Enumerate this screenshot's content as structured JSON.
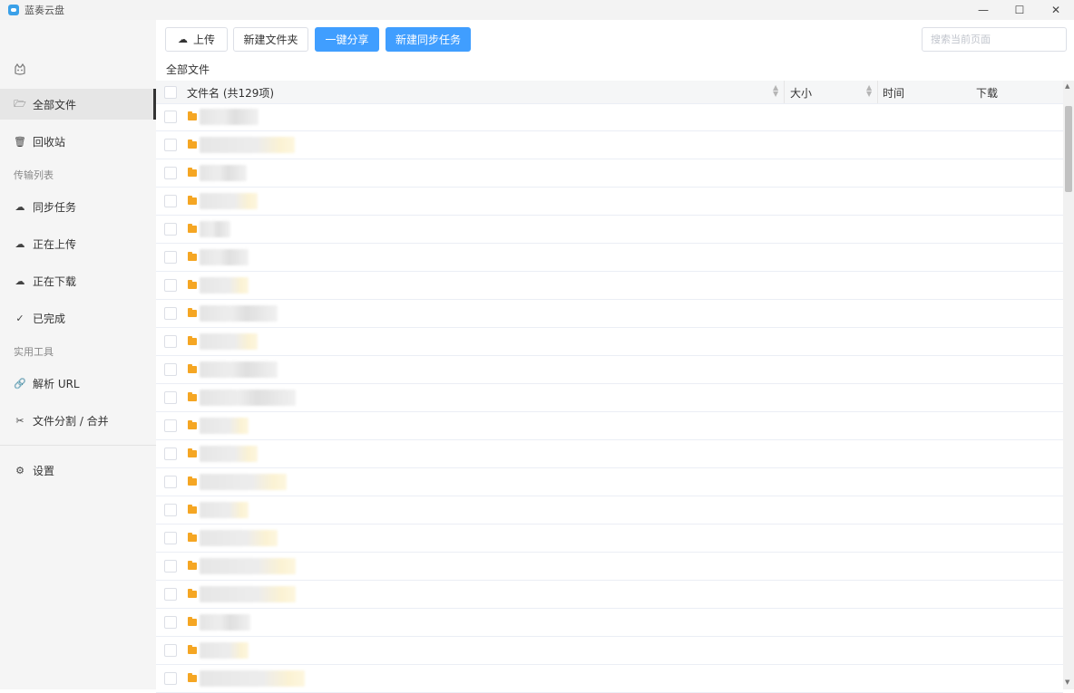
{
  "window": {
    "title": "蓝奏云盘",
    "controls": {
      "minimize": "—",
      "maximize": "☐",
      "close": "✕"
    }
  },
  "sidebar": {
    "cat_icon": "cat-icon",
    "items": [
      {
        "label": "全部文件",
        "icon": "folder-open-icon",
        "active": true
      },
      {
        "label": "回收站",
        "icon": "trash-icon",
        "active": false
      }
    ],
    "section_transfer": "传输列表",
    "transfer_items": [
      {
        "label": "同步任务",
        "icon": "sync-cloud-icon"
      },
      {
        "label": "正在上传",
        "icon": "upload-cloud-icon"
      },
      {
        "label": "正在下载",
        "icon": "download-cloud-icon"
      },
      {
        "label": "已完成",
        "icon": "check-circle-icon"
      }
    ],
    "section_tools": "实用工具",
    "tool_items": [
      {
        "label": "解析 URL",
        "icon": "link-icon"
      },
      {
        "label": "文件分割 / 合并",
        "icon": "scissors-icon"
      }
    ],
    "settings": {
      "label": "设置",
      "icon": "gear-icon"
    }
  },
  "toolbar": {
    "upload_label": "上传",
    "new_folder_label": "新建文件夹",
    "share_label": "一键分享",
    "sync_task_label": "新建同步任务",
    "search_placeholder": "搜索当前页面"
  },
  "breadcrumb": "全部文件",
  "table": {
    "col_name": "文件名 (共129项)",
    "col_size": "大小",
    "col_time": "时间",
    "col_download": "下载"
  },
  "colors": {
    "primary": "#409eff",
    "folder": "#f5a623",
    "sidebar_bg": "#f5f5f5"
  }
}
